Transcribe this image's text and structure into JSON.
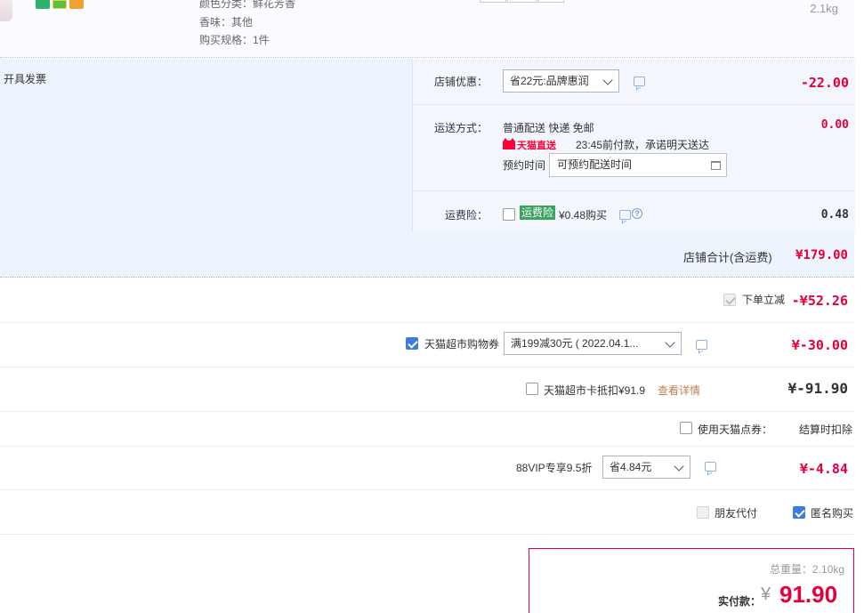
{
  "product": {
    "attrs": [
      "颜色分类：鲜花芳香",
      "香味：其他",
      "购买规格：1件"
    ],
    "weight": "2.1kg",
    "service_icons": [
      "seven-day-return-icon",
      "guarantee-icon",
      "coupon-icon"
    ]
  },
  "shop": {
    "invoice_label": "开具发票",
    "discount": {
      "label": "店铺优惠：",
      "selected": "省22元:品牌惠润",
      "amount": "-22.00"
    },
    "shipping": {
      "label": "运送方式：",
      "method": "普通配送 快递 免邮",
      "amount": "0.00",
      "tmall_badge": "天猫直送",
      "promise": "23:45前付款，承诺明天送达",
      "appointment_label": "预约时间",
      "appointment_placeholder": "可预约配送时间"
    },
    "insurance": {
      "label": "运费险：",
      "badge": "运费险",
      "price": "¥0.48购买",
      "amount": "0.48",
      "checked": false
    },
    "total": {
      "label": "店铺合计(含运费)",
      "value": "¥179.00"
    }
  },
  "discounts": {
    "instant": {
      "label": "下单立减",
      "amount": "-¥52.26"
    },
    "coupon": {
      "label": "天猫超市购物券",
      "selected": "满199减30元 ( 2022.04.1...",
      "amount": "¥-30.00",
      "checked": true
    },
    "card": {
      "label": "天猫超市卡抵扣¥91.9",
      "link": "查看详情",
      "amount": "¥-91.90",
      "checked": false
    },
    "points": {
      "label": "使用天猫点券：",
      "value": "结算时扣除",
      "checked": false
    },
    "vip": {
      "label": "88VIP专享9.5折",
      "selected": "省4.84元",
      "amount": "¥-4.84"
    },
    "options": {
      "friend_pay": "朋友代付",
      "anonymous": "匿名购买",
      "anonymous_checked": true
    }
  },
  "pay": {
    "weight": "总重量：2.10kg",
    "label": "实付款：",
    "currency": "¥",
    "amount": "91.90"
  }
}
